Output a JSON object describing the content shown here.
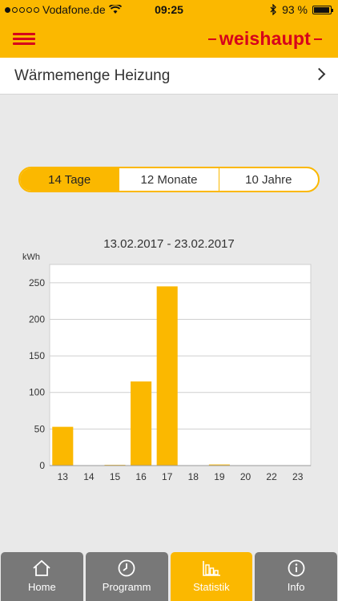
{
  "status_bar": {
    "carrier": "Vodafone.de",
    "time": "09:25",
    "battery": "93 %",
    "signal_bars_filled": 1,
    "signal_bars_total": 5,
    "battery_level": 0.93
  },
  "header": {
    "menu_icon": "hamburger-icon",
    "logo_text": "weishaupt",
    "brand_color": "#fbb800",
    "logo_color": "#d6001c"
  },
  "page": {
    "title": "Wärmemenge Heizung",
    "chevron_icon": "chevron-right-icon"
  },
  "segments": [
    {
      "label": "14 Tage",
      "active": true
    },
    {
      "label": "12 Monate",
      "active": false
    },
    {
      "label": "10 Jahre",
      "active": false
    }
  ],
  "chart_data": {
    "type": "bar",
    "title": "13.02.2017 - 23.02.2017",
    "ylabel": "kWh",
    "xlabel": "",
    "categories": [
      "13",
      "14",
      "15",
      "16",
      "17",
      "18",
      "19",
      "20",
      "22",
      "23"
    ],
    "values": [
      53,
      0,
      1,
      115,
      245,
      0.5,
      1.5,
      0.5,
      0,
      0.5
    ],
    "yticks": [
      0,
      50,
      100,
      150,
      200,
      250
    ],
    "ylim": [
      0,
      275
    ],
    "grid": true,
    "bar_color": "#fbb800"
  },
  "tabs": [
    {
      "label": "Home",
      "icon": "home-icon",
      "active": false
    },
    {
      "label": "Programm",
      "icon": "clock-icon",
      "active": false
    },
    {
      "label": "Statistik",
      "icon": "bar-chart-icon",
      "active": true
    },
    {
      "label": "Info",
      "icon": "info-icon",
      "active": false
    }
  ]
}
